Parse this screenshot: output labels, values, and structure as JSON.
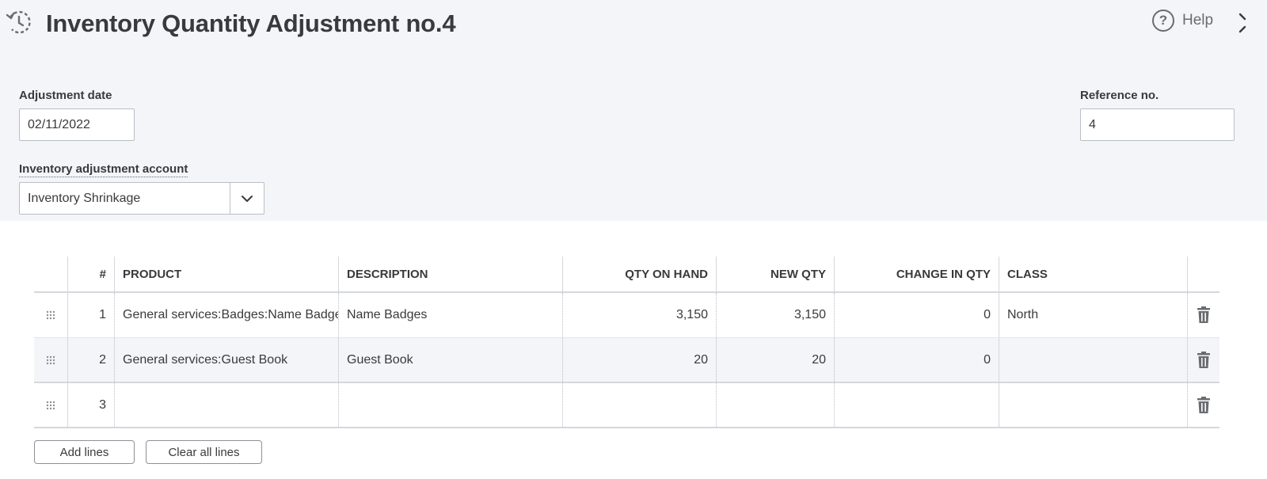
{
  "header": {
    "title": "Inventory Quantity Adjustment no.4",
    "help_label": "Help",
    "history_icon": "history-clock-icon",
    "help_icon": "question-circle-icon",
    "expand_icon": "expand-icon"
  },
  "form": {
    "adjustment_date_label": "Adjustment date",
    "adjustment_date_value": "02/11/2022",
    "reference_label": "Reference no.",
    "reference_value": "4",
    "account_label": "Inventory adjustment account",
    "account_value": "Inventory Shrinkage"
  },
  "table": {
    "columns": [
      "#",
      "PRODUCT",
      "DESCRIPTION",
      "QTY ON HAND",
      "NEW QTY",
      "CHANGE IN QTY",
      "CLASS"
    ],
    "rows": [
      {
        "num": "1",
        "product": "General services:Badges:Name Badges",
        "description": "Name Badges",
        "qty_on_hand": "3,150",
        "new_qty": "3,150",
        "change": "0",
        "class": "North"
      },
      {
        "num": "2",
        "product": "General services:Guest Book",
        "description": "Guest Book",
        "qty_on_hand": "20",
        "new_qty": "20",
        "change": "0",
        "class": ""
      },
      {
        "num": "3",
        "product": "",
        "description": "",
        "qty_on_hand": "",
        "new_qty": "",
        "change": "",
        "class": ""
      }
    ]
  },
  "buttons": {
    "add_lines": "Add lines",
    "clear_all_lines": "Clear all lines"
  },
  "colors": {
    "header_bg": "#f4f5f8",
    "text": "#393a3d",
    "border": "#babec5"
  }
}
